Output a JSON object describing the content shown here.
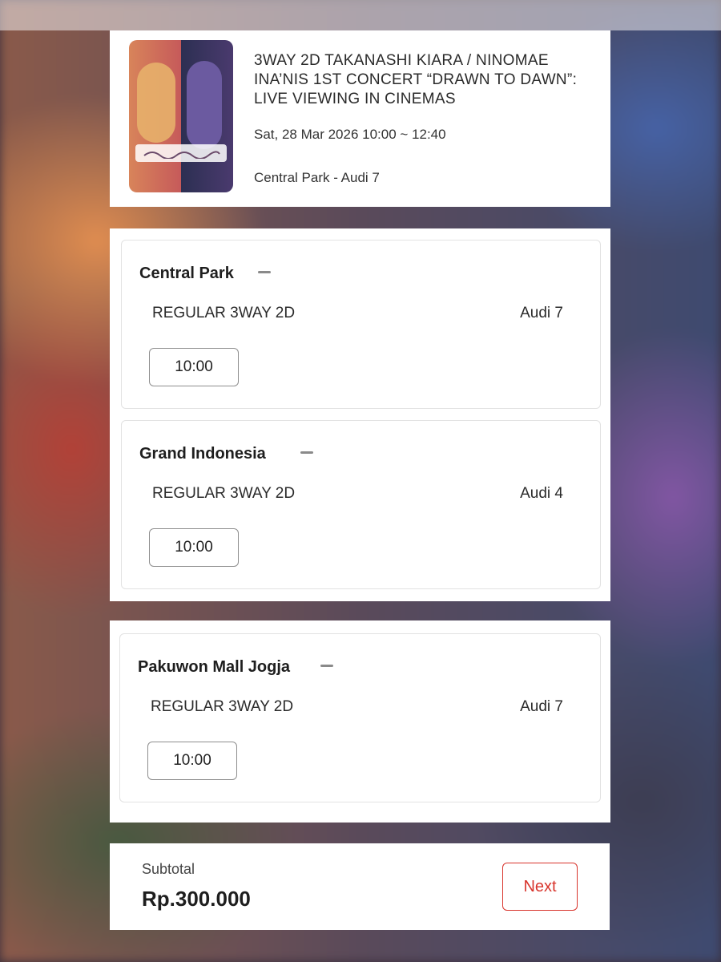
{
  "event": {
    "title": "3WAY 2D TAKANASHI KIARA / NINOMAE INA’NIS 1ST CONCERT “DRAWN TO DAWN”: LIVE VIEWING IN CINEMAS",
    "datetime": "Sat, 28 Mar 2026 10:00 ~ 12:40",
    "venue": "Central Park - Audi 7",
    "poster_icon": "event-poster-image"
  },
  "cinemas": [
    {
      "name": "Central Park",
      "format": "REGULAR 3WAY 2D",
      "audi": "Audi 7",
      "time": "10:00"
    },
    {
      "name": "Grand Indonesia",
      "format": "REGULAR 3WAY 2D",
      "audi": "Audi 4",
      "time": "10:00"
    },
    {
      "name": "Pakuwon Mall Jogja",
      "format": "REGULAR 3WAY 2D",
      "audi": "Audi 7",
      "time": "10:00"
    }
  ],
  "footer": {
    "subtotal_label": "Subtotal",
    "subtotal_value": "Rp.300.000",
    "next_label": "Next"
  },
  "colors": {
    "accent": "#d8342c",
    "text": "#1e1e1e",
    "border": "#e2e2e2"
  }
}
